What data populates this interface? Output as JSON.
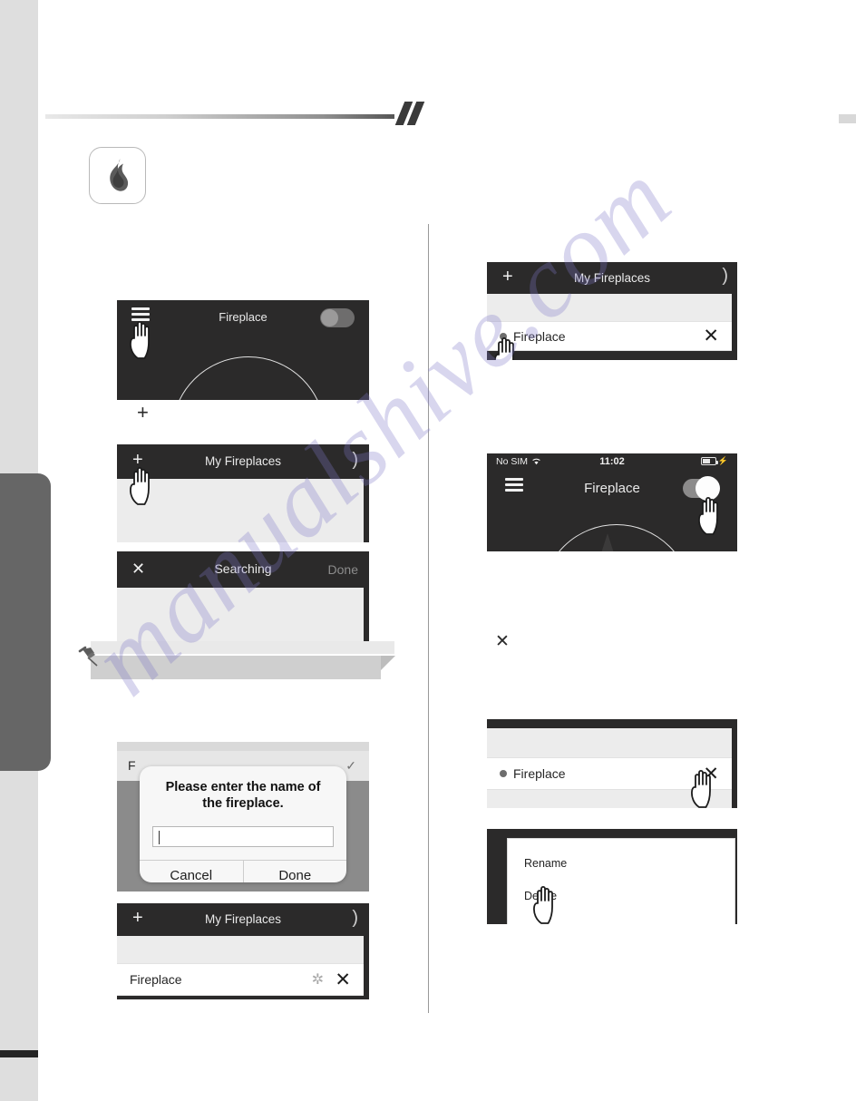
{
  "page": {
    "watermark": "manualshive.com"
  },
  "app_icon": {
    "name": "flame-icon"
  },
  "left_column": {
    "shot_home": {
      "navbar": {
        "left_icon": "hamburger-icon",
        "title": "Fireplace",
        "toggle_state": "off"
      },
      "hand": "tap-hand-cursor"
    },
    "glyph_plus": "+",
    "shot_my_fireplaces": {
      "navbar": {
        "left_action": "+",
        "title": "My Fireplaces",
        "right_icon": "chevron"
      },
      "hand": "tap-hand-cursor"
    },
    "shot_searching": {
      "navbar": {
        "left_action": "✕",
        "title": "Searching",
        "right_action": "Done"
      }
    },
    "note": {
      "pin": "pushpin-icon"
    },
    "shot_dialog": {
      "behind_row_text": "F",
      "behind_row_check": "✓",
      "dialog": {
        "title": "Please enter the name of the fireplace.",
        "input_value": "",
        "cancel_label": "Cancel",
        "done_label": "Done"
      }
    },
    "shot_added": {
      "navbar": {
        "left_action": "+",
        "title": "My Fireplaces",
        "right_icon": "chevron"
      },
      "row": {
        "label": "Fireplace",
        "spinner": "loading-spinner",
        "close": "✕"
      }
    }
  },
  "right_column": {
    "shot_list_select": {
      "navbar": {
        "left_action": "+",
        "title": "My Fireplaces",
        "right_icon": "chevron"
      },
      "row": {
        "label": "Fireplace",
        "close": "✕"
      },
      "hand": "tap-hand-cursor"
    },
    "shot_control": {
      "statusbar": {
        "carrier": "No SIM",
        "wifi": "wifi-icon",
        "time": "11:02",
        "battery": "battery-charging-icon"
      },
      "navbar": {
        "left_icon": "hamburger-icon",
        "title": "Fireplace",
        "toggle_state": "on"
      },
      "hand": "tap-hand-cursor"
    },
    "glyph_x": "✕",
    "shot_list_delete": {
      "row": {
        "label": "Fireplace",
        "close": "✕"
      },
      "hand": "tap-hand-cursor"
    },
    "shot_menu": {
      "items": [
        "Rename",
        "Delete"
      ],
      "hand": "tap-hand-cursor"
    }
  }
}
